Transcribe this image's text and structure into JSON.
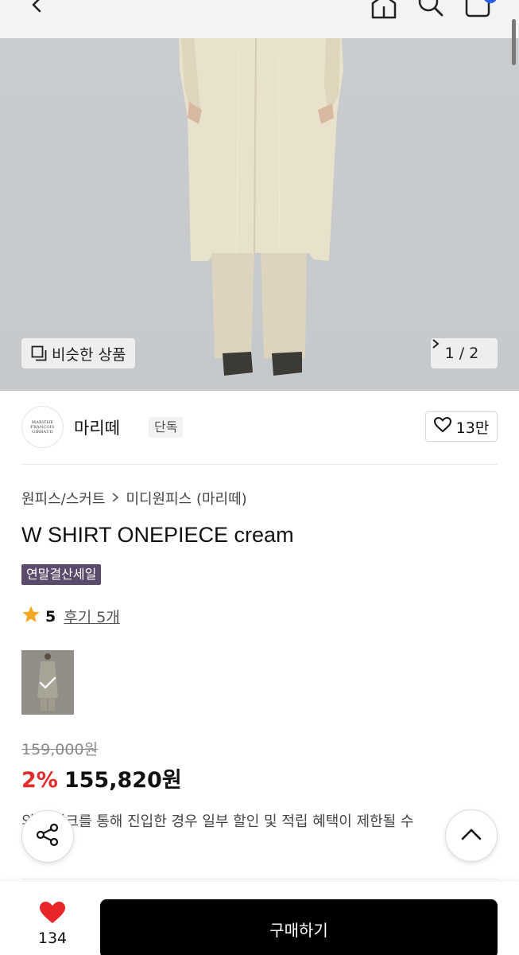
{
  "header": {
    "icons": [
      "back-icon",
      "home-icon",
      "search-icon",
      "bag-icon"
    ],
    "accent": "#2b5ce6"
  },
  "hero": {
    "similar_label": "비슷한 상품",
    "pager_label": "1 / 2"
  },
  "brand": {
    "logo_lines": [
      "MARITHE",
      "FRANCOIS",
      "GIRBAUD"
    ],
    "name": "마리떼",
    "tag": "단독",
    "likes": "13만"
  },
  "breadcrumb": {
    "category": "원피스/스커트",
    "subcategory": "미디원피스 (마리떼)"
  },
  "product": {
    "title": "W SHIRT ONEPIECE cream",
    "sale_tag": "연말결산세일",
    "rating": "5",
    "reviews": "후기 5개",
    "original_price": "159,000원",
    "discount": "2%",
    "price": "155,820원",
    "notice": "외부 링크를 통해 진입한 경우 일부 할인 및 적립 혜택이 제한될 수"
  },
  "colors": {
    "discount": "#e22b2b",
    "sale_tag_bg": "#5b4a6b",
    "star": "#f5a623",
    "heart": "#e8262a"
  },
  "bottom": {
    "wish_count": "134",
    "buy_label": "구매하기"
  }
}
